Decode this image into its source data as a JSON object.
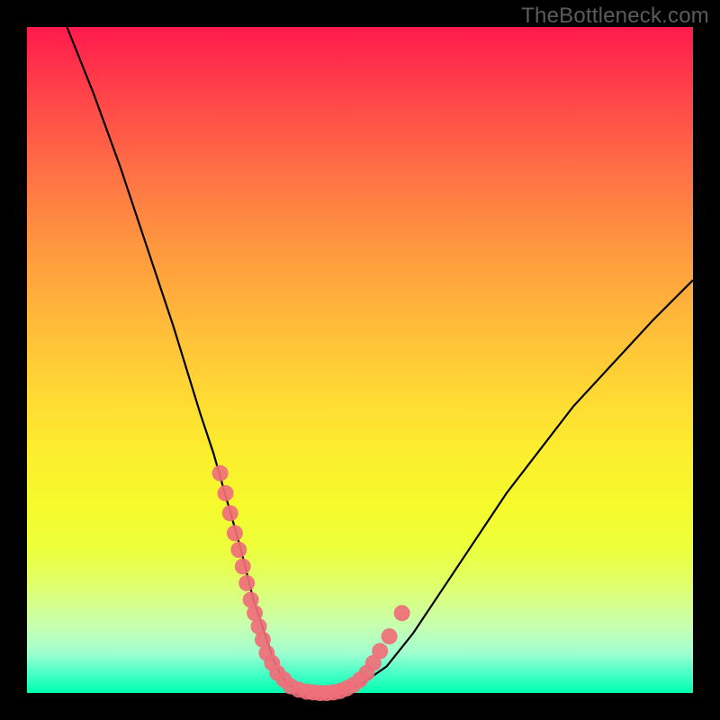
{
  "watermark": "TheBottleneck.com",
  "chart_data": {
    "type": "line",
    "title": "",
    "xlabel": "",
    "ylabel": "",
    "xlim": [
      0,
      100
    ],
    "ylim": [
      0,
      100
    ],
    "curve": {
      "x": [
        6,
        10,
        14,
        18,
        22,
        26,
        28,
        30,
        32,
        33,
        34,
        35,
        36,
        37,
        38,
        39,
        40,
        41,
        42,
        43,
        45,
        47,
        50,
        54,
        58,
        64,
        72,
        82,
        94,
        100
      ],
      "y": [
        100,
        90,
        79,
        67,
        55,
        42,
        36,
        29,
        22,
        18,
        14,
        11,
        8,
        5,
        3,
        1.5,
        0.8,
        0.3,
        0.1,
        0,
        0,
        0.2,
        1.2,
        4,
        9,
        18,
        30,
        43,
        56,
        62
      ]
    },
    "markers": {
      "x": [
        29.0,
        29.8,
        30.5,
        31.2,
        31.8,
        32.4,
        33.0,
        33.6,
        34.2,
        34.8,
        35.4,
        36.0,
        36.8,
        37.6,
        38.6,
        39.6,
        40.8,
        42.0,
        43.0,
        44.0,
        45.0,
        46.0,
        47.0,
        48.0,
        49.0,
        50.0,
        51.0,
        52.0,
        53.0,
        54.4,
        56.3
      ],
      "y": [
        33.0,
        30.0,
        27.0,
        24.0,
        21.5,
        19.0,
        16.5,
        14.0,
        12.0,
        10.0,
        8.0,
        6.0,
        4.5,
        3.0,
        2.0,
        1.0,
        0.5,
        0.2,
        0.1,
        0.0,
        0.0,
        0.1,
        0.3,
        0.7,
        1.2,
        2.0,
        3.0,
        4.5,
        6.3,
        8.5,
        12.0
      ]
    },
    "marker_color": "#ef6f79",
    "curve_color": "#000000"
  }
}
